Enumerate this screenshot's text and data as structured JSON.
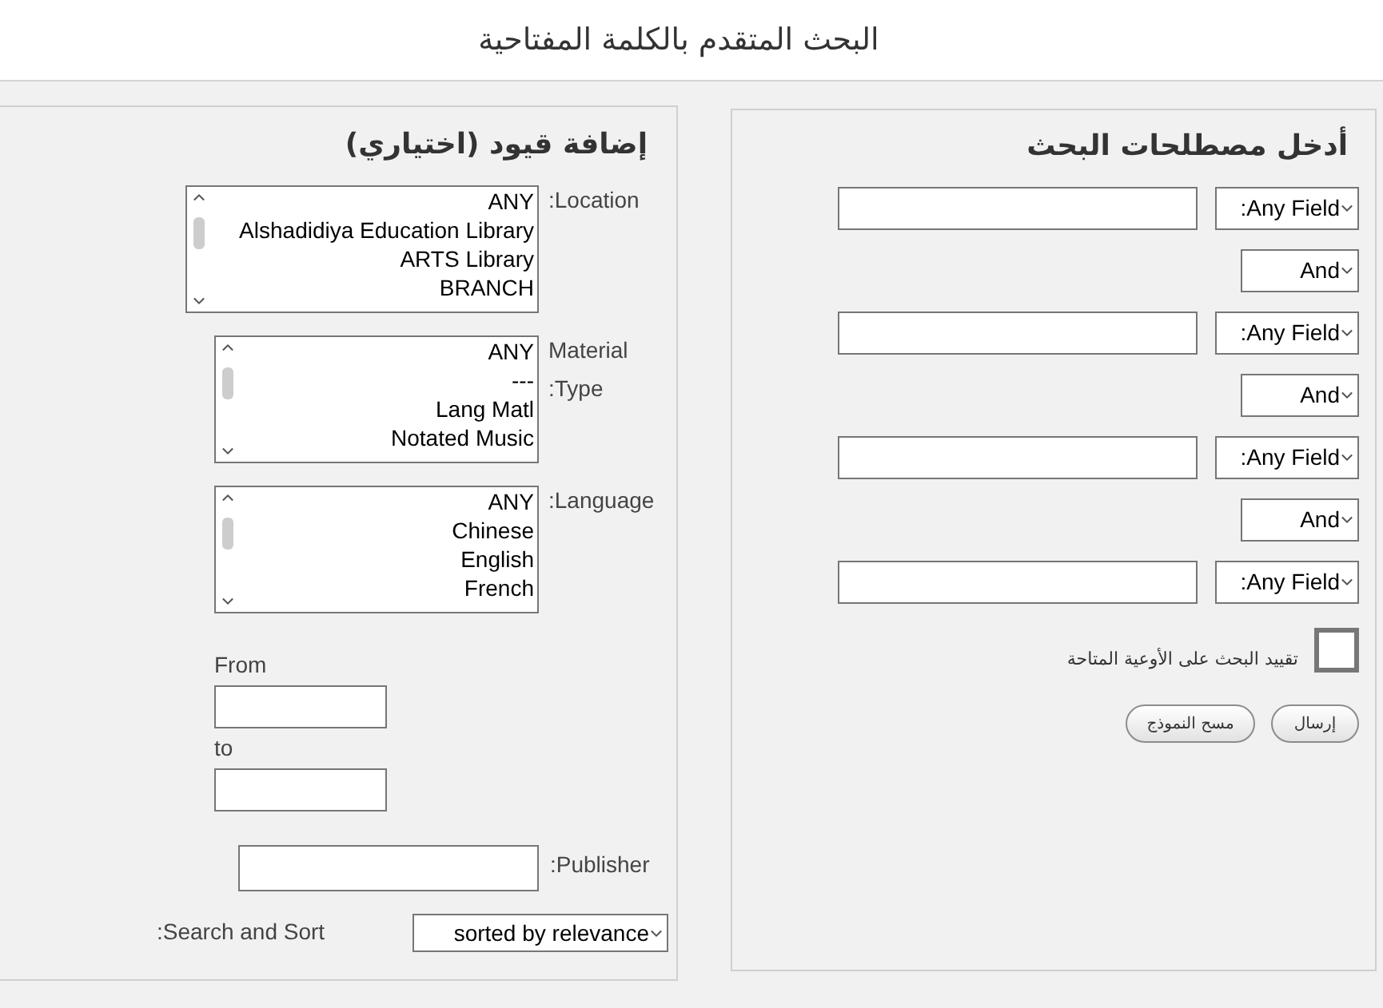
{
  "page_title": "البحث المتقدم بالكلمة المفتاحية",
  "limits": {
    "heading": "إضافة قيود (اختياري)",
    "listboxes": [
      {
        "label": ":Location",
        "options": [
          "ANY",
          "Alshadidiya Education Library",
          "ARTS Library",
          "BRANCH"
        ]
      },
      {
        "label": "Material :Type",
        "options": [
          "ANY",
          "---",
          "Lang Matl",
          "Notated Music"
        ]
      },
      {
        "label": ":Language",
        "options": [
          "ANY",
          "Chinese",
          "English",
          "French"
        ]
      }
    ],
    "date_range": {
      "from_label": "From",
      "to_label": "to"
    },
    "publisher": {
      "label": ":Publisher"
    },
    "sort": {
      "label": ":Search and Sort",
      "value": "sorted by relevance"
    }
  },
  "search_terms": {
    "heading": "أدخل مصطلحات البحث",
    "rows": [
      {
        "kind": "term",
        "field": ":Any Field"
      },
      {
        "kind": "operator",
        "value": "And"
      },
      {
        "kind": "term",
        "field": ":Any Field"
      },
      {
        "kind": "operator",
        "value": "And"
      },
      {
        "kind": "term",
        "field": ":Any Field"
      },
      {
        "kind": "operator",
        "value": "And"
      },
      {
        "kind": "term",
        "field": ":Any Field"
      }
    ],
    "limit_available": {
      "label": "تقييد البحث على الأوعية المتاحة",
      "checked": false
    },
    "buttons": [
      {
        "label": "إرسال"
      },
      {
        "label": "مسح النموذج"
      }
    ]
  }
}
